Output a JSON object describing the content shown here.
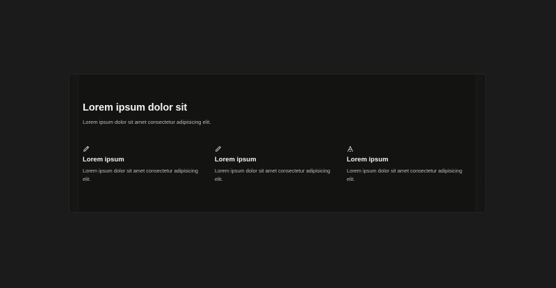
{
  "section": {
    "title": "Lorem ipsum dolor sit",
    "subtitle": "Lorem ipsum dolor sit amet consectetur adipisicing elit."
  },
  "features": [
    {
      "icon": "pencil-icon",
      "title": "Lorem ipsum",
      "description": "Lorem ipsum dolor sit amet consectetur adipisicing elit."
    },
    {
      "icon": "pen-icon",
      "title": "Lorem ipsum",
      "description": "Lorem ipsum dolor sit amet consectetur adipisicing elit."
    },
    {
      "icon": "text-a-icon",
      "title": "Lorem ipsum",
      "description": "Lorem ipsum dolor sit amet consectetur adipisicing elit."
    }
  ],
  "colors": {
    "page_background": "#1b1b1b",
    "card_background": "#131311",
    "heading_text": "#f4f4f2",
    "body_text": "#bdbdb8"
  }
}
